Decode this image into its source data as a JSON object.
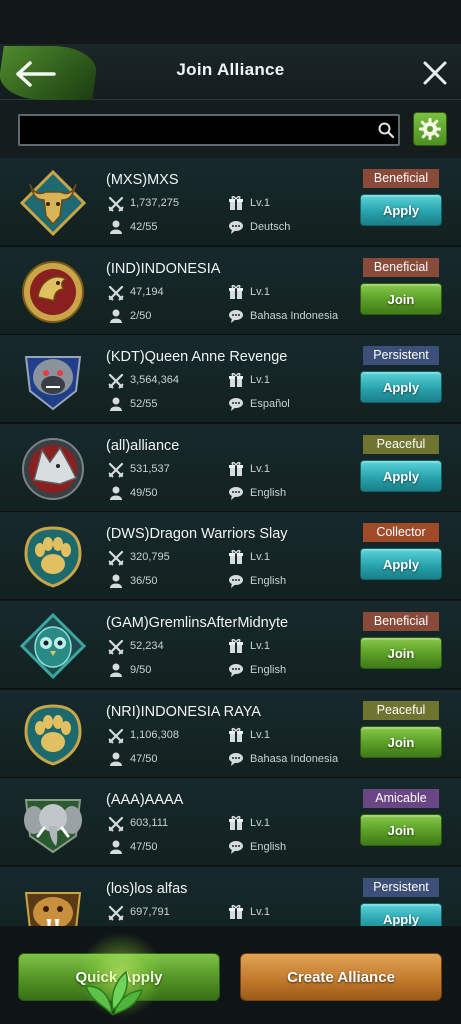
{
  "header": {
    "title": "Join Alliance"
  },
  "search": {
    "value": "",
    "placeholder": ""
  },
  "colors": {
    "beneficial": "#8a4a3a",
    "persistent": "#3c4f78",
    "peaceful": "#6f7431",
    "collector": "#a04a2a",
    "amicable": "#6a4684"
  },
  "alliances": [
    {
      "name": "(MXS)MXS",
      "power": "1,737,275",
      "level": "Lv.1",
      "members": "42/55",
      "language": "Deutsch",
      "tag": "Beneficial",
      "tag_color": "#8a4a3a",
      "action": "Apply",
      "emblem": "bull-emblem-icon"
    },
    {
      "name": "(IND)INDONESIA",
      "power": "47,194",
      "level": "Lv.1",
      "members": "2/50",
      "language": "Bahasa Indonesia",
      "tag": "Beneficial",
      "tag_color": "#8a4a3a",
      "action": "Join",
      "emblem": "eagle-emblem-icon"
    },
    {
      "name": "(KDT)Queen Anne Revenge",
      "power": "3,564,364",
      "level": "Lv.1",
      "members": "52/55",
      "language": "Español",
      "tag": "Persistent",
      "tag_color": "#3c4f78",
      "action": "Apply",
      "emblem": "gorilla-emblem-icon"
    },
    {
      "name": "(all)alliance",
      "power": "531,537",
      "level": "Lv.1",
      "members": "49/50",
      "language": "English",
      "tag": "Peaceful",
      "tag_color": "#6f7431",
      "action": "Apply",
      "emblem": "wolf-emblem-icon"
    },
    {
      "name": "(DWS)Dragon Warriors Slay",
      "power": "320,795",
      "level": "Lv.1",
      "members": "36/50",
      "language": "English",
      "tag": "Collector",
      "tag_color": "#a04a2a",
      "action": "Apply",
      "emblem": "paw-emblem-icon"
    },
    {
      "name": "(GAM)GremlinsAfterMidnyte",
      "power": "52,234",
      "level": "Lv.1",
      "members": "9/50",
      "language": "English",
      "tag": "Beneficial",
      "tag_color": "#8a4a3a",
      "action": "Join",
      "emblem": "owl-emblem-icon"
    },
    {
      "name": "(NRI)INDONESIA RAYA",
      "power": "1,106,308",
      "level": "Lv.1",
      "members": "47/50",
      "language": "Bahasa Indonesia",
      "tag": "Peaceful",
      "tag_color": "#6f7431",
      "action": "Join",
      "emblem": "paw-emblem-icon"
    },
    {
      "name": "(AAA)AAAA",
      "power": "603,111",
      "level": "Lv.1",
      "members": "47/50",
      "language": "English",
      "tag": "Amicable",
      "tag_color": "#6a4684",
      "action": "Join",
      "emblem": "elephant-emblem-icon"
    },
    {
      "name": "(los)los alfas",
      "power": "697,791",
      "level": "Lv.1",
      "members": "",
      "language": "",
      "tag": "Persistent",
      "tag_color": "#3c4f78",
      "action": "Apply",
      "emblem": "sabertooth-emblem-icon"
    }
  ],
  "footer": {
    "quick_apply": "Quick Apply",
    "create_alliance": "Create Alliance"
  }
}
